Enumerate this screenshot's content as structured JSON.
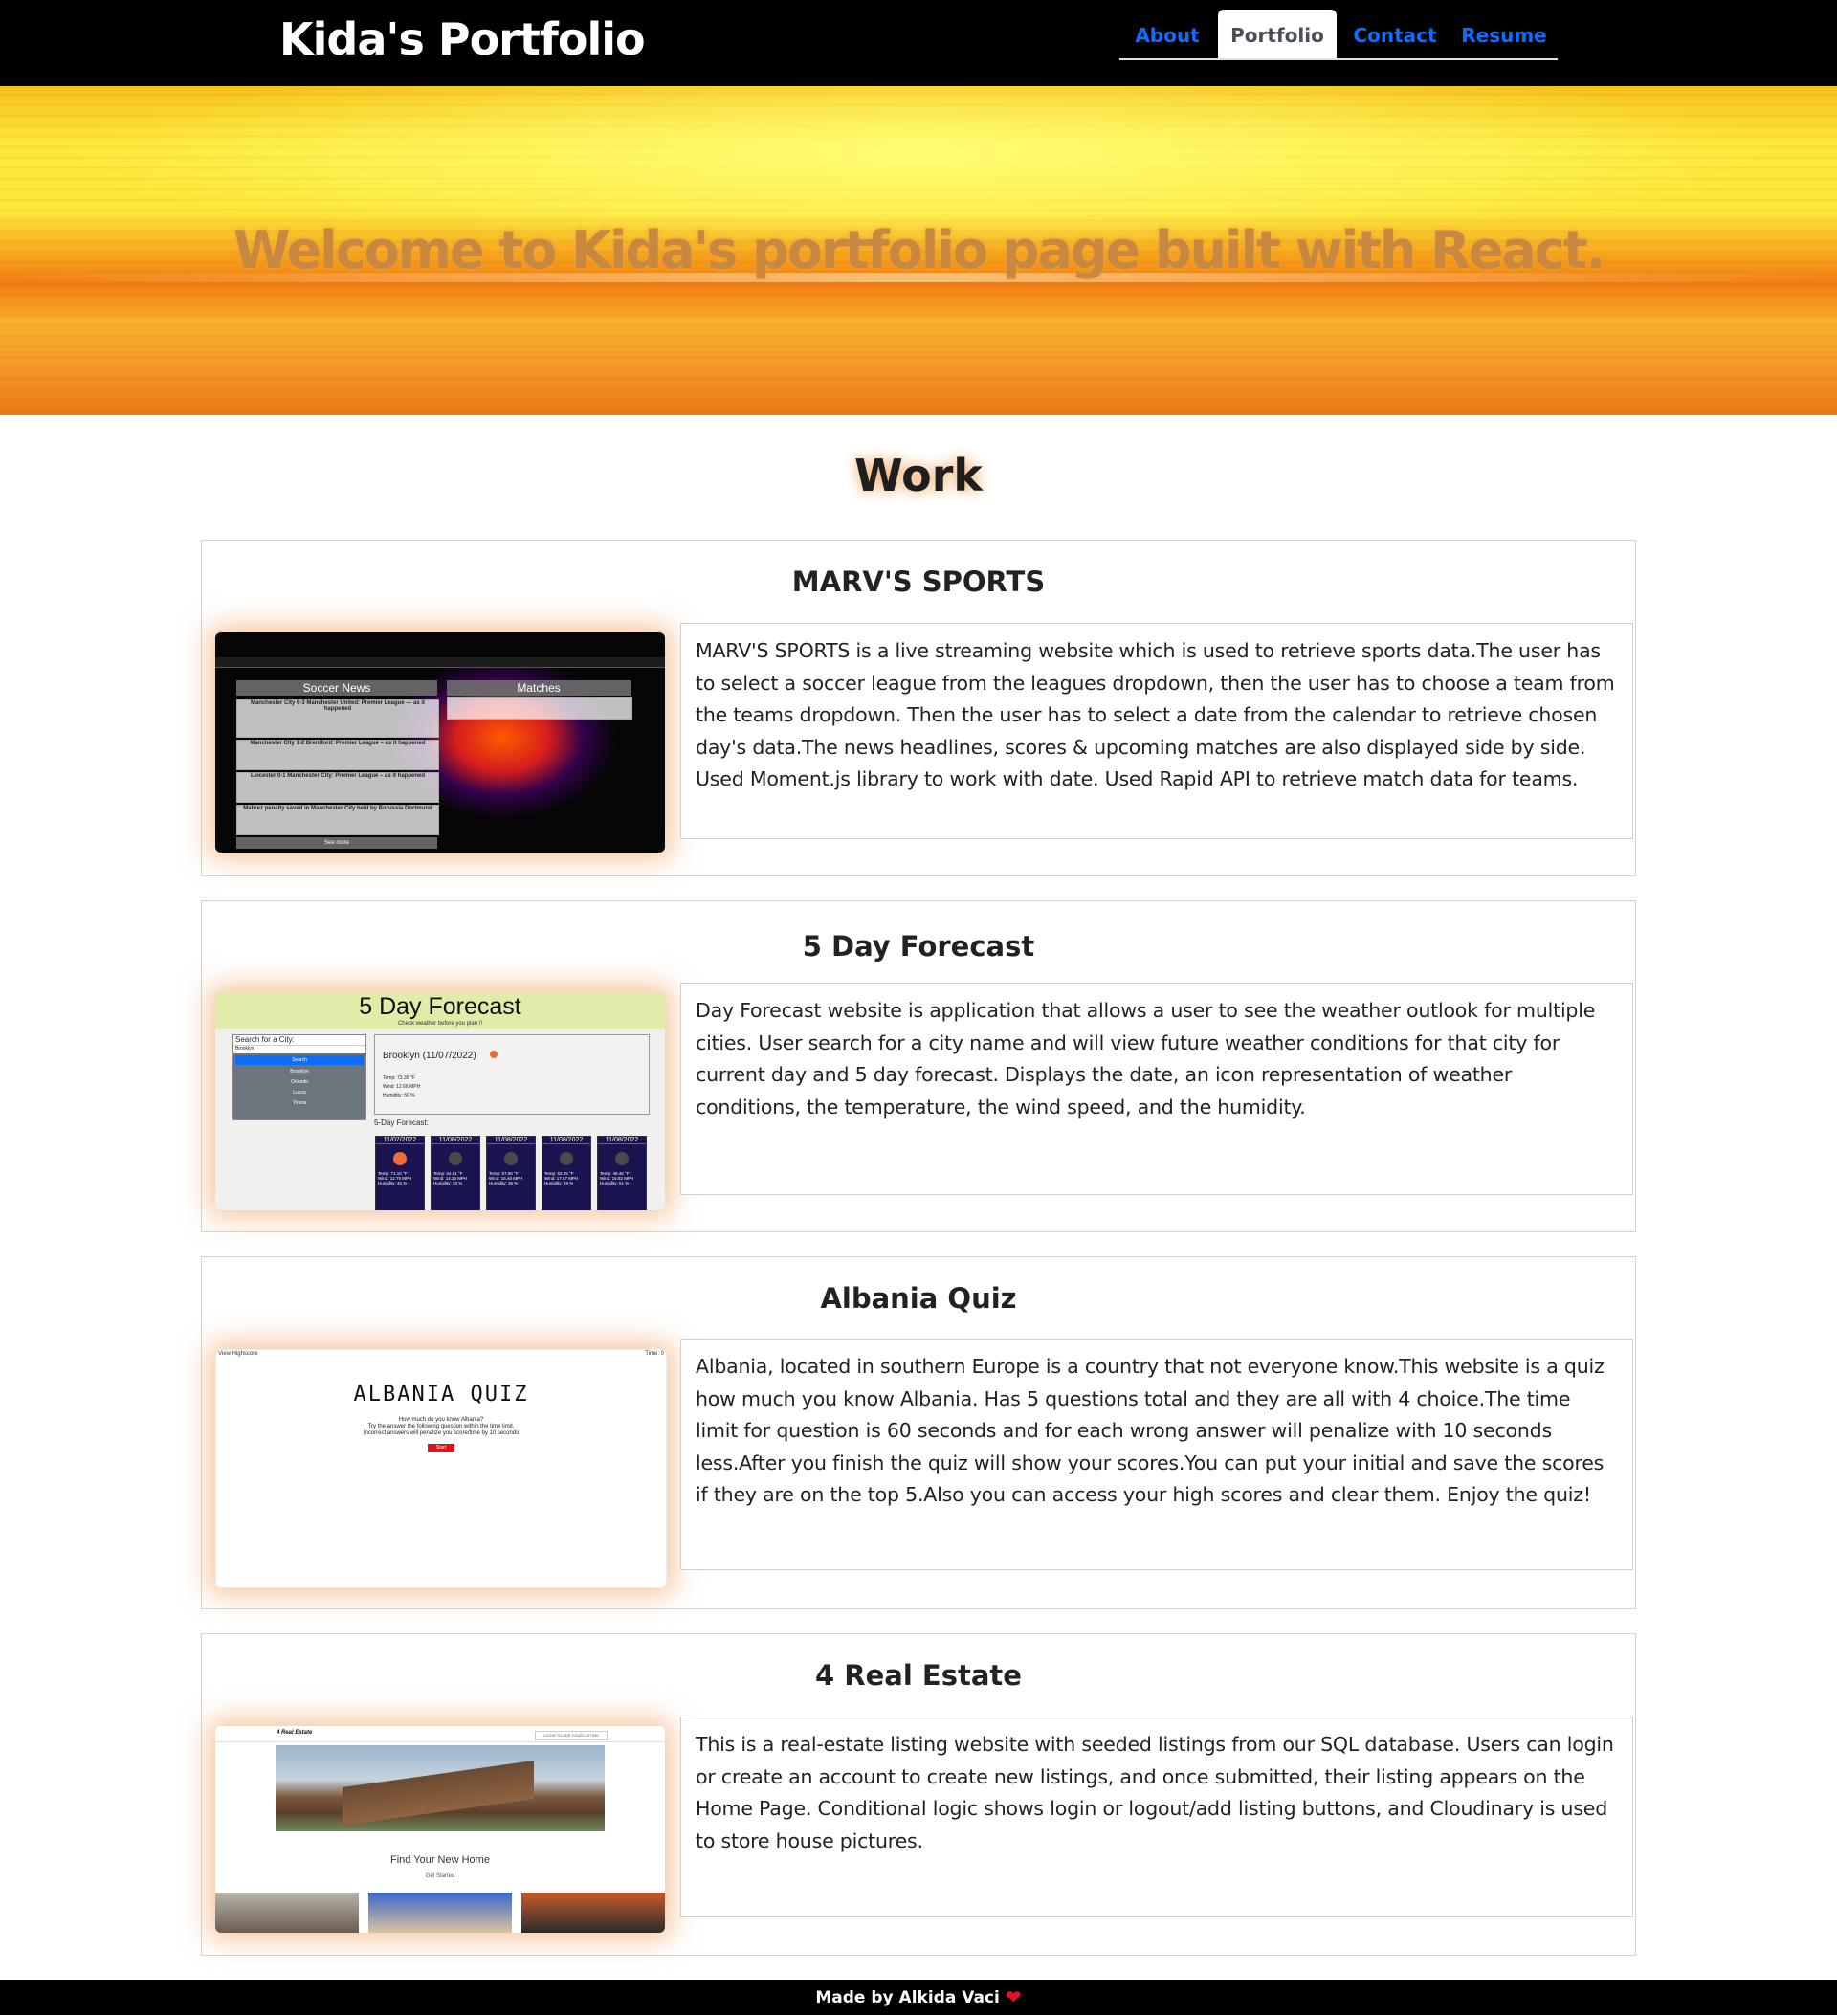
{
  "header": {
    "brand": "Kida's Portfolio",
    "tabs": [
      {
        "label": "About"
      },
      {
        "label": "Portfolio"
      },
      {
        "label": "Contact"
      },
      {
        "label": "Resume"
      }
    ]
  },
  "hero": {
    "title": "Welcome to Kida's portfolio page built with React."
  },
  "work": {
    "title": "Work",
    "projects": [
      {
        "title": "MARV'S SPORTS",
        "description": "MARV'S SPORTS is a live streaming website which is used to retrieve sports data.The user has to select a soccer league from the leagues dropdown, then the user has to choose a team from the teams dropdown. Then the user has to select a date from the calendar to retrieve chosen day's data.The news headlines, scores & upcoming matches are also displayed side by side. Used Moment.js library to work with date. Used Rapid API to retrieve match data for teams.",
        "screenshot": {
          "left_heading": "Soccer News",
          "right_heading": "Matches",
          "headlines": [
            "Manchester City 6-3 Manchester United: Premier League — as it happened",
            "Manchester City 1-2 Brentford: Premier League – as it happened",
            "Leicester 0-1 Manchester City: Premier League – as it happened",
            "Mahrez penalty saved in Manchester City held by Borussia Dortmund"
          ],
          "footer": "See more"
        }
      },
      {
        "title": "5 Day Forecast",
        "description": "Day Forecast website is application that allows a user to see the weather outlook for multiple cities. User search for a city name and will view future weather conditions for that city for current day and 5 day forecast. Displays the date, an icon representation of weather conditions, the temperature, the wind speed, and the humidity.",
        "screenshot": {
          "app_title": "5 Day Forecast",
          "subtitle": "Check weather before you plan !!",
          "search_label": "Search for a City:",
          "search_value": "Brooklyn",
          "search_button": "Search",
          "history": [
            "Brooklyn",
            "Orlando",
            "Lucca",
            "Tirana"
          ],
          "current_city": "Brooklyn (11/07/2022)",
          "current_temp": "Temp: 73.35 °F",
          "current_wind": "Wind: 12.66 MPH",
          "current_humidity": "Humidity: 50 %",
          "forecast_label": "5-Day Forecast:",
          "days": [
            {
              "date": "11/07/2022",
              "temp": "Temp: 71.10 °F",
              "wind": "Wind: 12.75 MPH",
              "humidity": "Humidity: 45 %"
            },
            {
              "date": "11/08/2022",
              "temp": "Temp: 64.51 °F",
              "wind": "Wind: 14.36 MPH",
              "humidity": "Humidity: 33 %"
            },
            {
              "date": "11/08/2022",
              "temp": "Temp: 57.06 °F",
              "wind": "Wind: 16.46 MPH",
              "humidity": "Humidity: 36 %"
            },
            {
              "date": "11/08/2022",
              "temp": "Temp: 52.25 °F",
              "wind": "Wind: 17.67 MPH",
              "humidity": "Humidity: 48 %"
            },
            {
              "date": "11/08/2022",
              "temp": "Temp: 49.46 °F",
              "wind": "Wind: 15.82 MPH",
              "humidity": "Humidity: 51 %"
            }
          ]
        }
      },
      {
        "title": "Albania Quiz",
        "description": "Albania, located in southern Europe is a country that not everyone know.This website is a quiz how much you know Albania. Has 5 questions total and they are all with 4 choice.The time limit for question is 60 seconds and for each wrong answer will penalize with 10 seconds less.After you finish the quiz will show your scores.You can put your initial and save the scores if they are on the top 5.Also you can access your high scores and clear them. Enjoy the quiz!",
        "screenshot": {
          "top_left": "View Highscore",
          "top_right": "Time: 0",
          "quiz_title": "ALBANIA QUIZ",
          "line1": "How much do you know Albania?",
          "line2": "Try the answer the following question within the time limit.",
          "line3": "Incorrect answers will penalize you score/time by 10 seconds",
          "start_button": "Start"
        }
      },
      {
        "title": "4 Real Estate",
        "description": "This is a real-estate listing website with seeded listings from our SQL database. Users can login or create an account to create new listings, and once submitted, their listing appears on the Home Page. Conditional logic shows login or logout/add listing buttons, and Cloudinary is used to store house pictures.",
        "screenshot": {
          "logo": "4 Real Estate",
          "login_button": "LOGIN TO ADD YOUR LISTING",
          "headline": "Find Your New Home",
          "cta": "Get Started"
        }
      }
    ]
  },
  "footer": {
    "text": "Made by Alkida Vaci"
  }
}
